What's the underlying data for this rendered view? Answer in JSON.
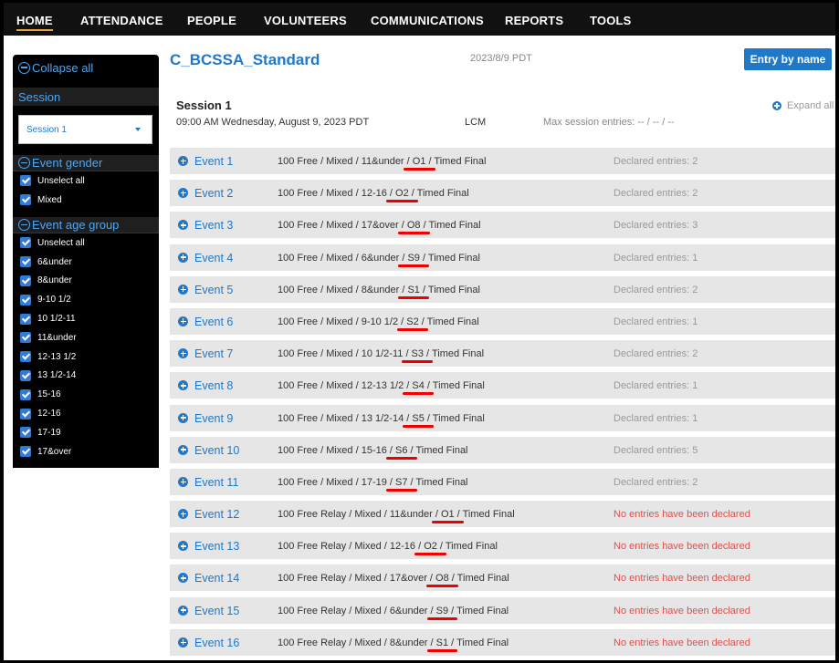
{
  "nav": [
    "HOME",
    "ATTENDANCE",
    "PEOPLE",
    "VOLUNTEERS",
    "COMMUNICATIONS",
    "REPORTS",
    "TOOLS"
  ],
  "sidebar": {
    "collapse_all": "Collapse all",
    "session_heading": "Session",
    "session_selected": "Session 1",
    "gender_heading": "Event gender",
    "gender_options": [
      "Unselect all",
      "Mixed"
    ],
    "age_heading": "Event age group",
    "age_options": [
      "Unselect all",
      "6&under",
      "8&under",
      "9-10 1/2",
      "10 1/2-11",
      "11&under",
      "12-13 1/2",
      "13 1/2-14",
      "15-16",
      "12-16",
      "17-19",
      "17&over"
    ]
  },
  "header": {
    "title": "C_BCSSA_Standard",
    "date": "2023/8/9 PDT",
    "entry_button": "Entry by name"
  },
  "session": {
    "name": "Session 1",
    "time": "09:00 AM Wednesday, August 9, 2023 PDT",
    "course": "LCM",
    "max_entries": "Max session entries: -- / -- / --",
    "expand_all": "Expand all"
  },
  "events": [
    {
      "label": "Event 1",
      "pre": "100 Free / Mixed / 11&under ",
      "code": "/ O1 /",
      "post": " Timed Final",
      "status": "Declared entries: 2",
      "none": false
    },
    {
      "label": "Event 2",
      "pre": "100 Free / Mixed / 12-16 ",
      "code": "/ O2 /",
      "post": " Timed Final",
      "status": "Declared entries: 2",
      "none": false
    },
    {
      "label": "Event 3",
      "pre": "100 Free / Mixed / 17&over ",
      "code": "/ O8 /",
      "post": " Timed Final",
      "status": "Declared entries: 3",
      "none": false
    },
    {
      "label": "Event 4",
      "pre": "100 Free / Mixed / 6&under ",
      "code": "/ S9 /",
      "post": " Timed Final",
      "status": "Declared entries: 1",
      "none": false
    },
    {
      "label": "Event 5",
      "pre": "100 Free / Mixed / 8&under ",
      "code": "/ S1 /",
      "post": " Timed Final",
      "status": "Declared entries: 2",
      "none": false
    },
    {
      "label": "Event 6",
      "pre": "100 Free / Mixed / 9-10 1/2 ",
      "code": "/ S2 /",
      "post": " Timed Final",
      "status": "Declared entries: 1",
      "none": false
    },
    {
      "label": "Event 7",
      "pre": "100 Free / Mixed / 10 1/2-11 ",
      "code": "/ S3 /",
      "post": " Timed Final",
      "status": "Declared entries: 2",
      "none": false
    },
    {
      "label": "Event 8",
      "pre": "100 Free / Mixed / 12-13 1/2 ",
      "code": "/ S4 /",
      "post": " Timed Final",
      "status": "Declared entries: 1",
      "none": false
    },
    {
      "label": "Event 9",
      "pre": "100 Free / Mixed / 13 1/2-14 ",
      "code": "/ S5 /",
      "post": " Timed Final",
      "status": "Declared entries: 1",
      "none": false
    },
    {
      "label": "Event 10",
      "pre": "100 Free / Mixed / 15-16 ",
      "code": "/ S6 /",
      "post": " Timed Final",
      "status": "Declared entries: 5",
      "none": false
    },
    {
      "label": "Event 11",
      "pre": "100 Free / Mixed / 17-19 ",
      "code": "/ S7 /",
      "post": " Timed Final",
      "status": "Declared entries: 2",
      "none": false
    },
    {
      "label": "Event 12",
      "pre": "100 Free Relay / Mixed / 11&under ",
      "code": "/ O1 /",
      "post": " Timed Final",
      "status": "No entries have been declared",
      "none": true
    },
    {
      "label": "Event 13",
      "pre": "100 Free Relay / Mixed / 12-16 ",
      "code": "/ O2 /",
      "post": " Timed Final",
      "status": "No entries have been declared",
      "none": true
    },
    {
      "label": "Event 14",
      "pre": "100 Free Relay / Mixed / 17&over ",
      "code": "/ O8 /",
      "post": " Timed Final",
      "status": "No entries have been declared",
      "none": true
    },
    {
      "label": "Event 15",
      "pre": "100 Free Relay / Mixed / 6&under ",
      "code": "/ S9 /",
      "post": " Timed Final",
      "status": "No entries have been declared",
      "none": true
    },
    {
      "label": "Event 16",
      "pre": "100 Free Relay / Mixed / 8&under ",
      "code": "/ S1 /",
      "post": " Timed Final",
      "status": "No entries have been declared",
      "none": true
    }
  ]
}
